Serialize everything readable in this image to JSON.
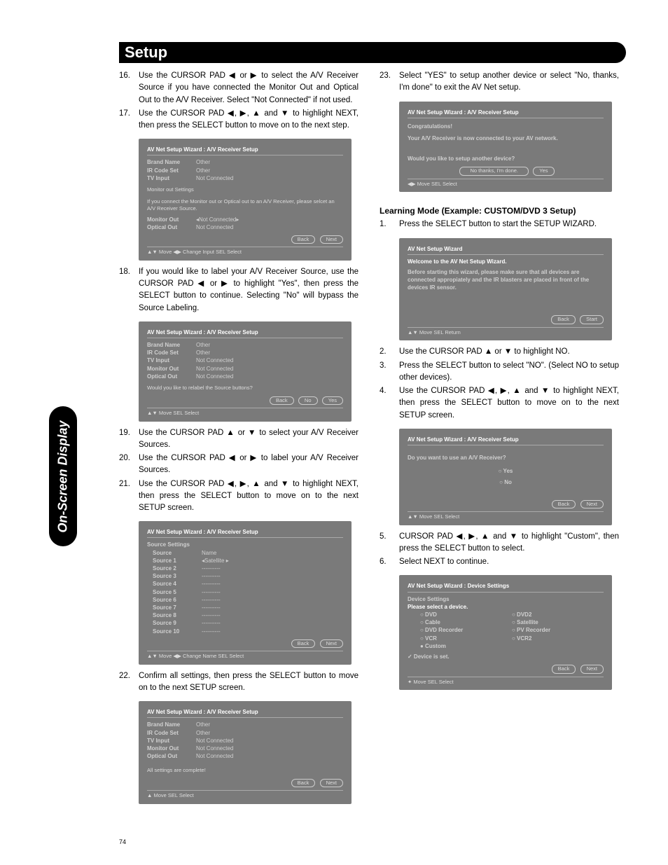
{
  "header": "Setup",
  "sidetab": "On-Screen Display",
  "pagenum": "74",
  "left": {
    "step16": "Use the CURSOR PAD ◀ or ▶ to select the A/V Receiver Source if you have connected the Monitor Out and Optical Out to the A/V Receiver.  Select \"Not Connected\" if not used.",
    "step17": "Use the CURSOR PAD ◀, ▶, ▲ and ▼ to highlight NEXT, then press the SELECT button to move on to the next step.",
    "screen1": {
      "title": "AV Net Setup Wizard : A/V Receiver Setup",
      "rows": [
        [
          "Brand Name",
          "Other"
        ],
        [
          "IR Code Set",
          "Other"
        ],
        [
          "TV Input",
          "Not Connected"
        ]
      ],
      "note1": "Monitor out Settings",
      "note2": "If you connect the Monitor out or Optical out to an A/V Receiver, please selcet an A/V Receiver Source.",
      "rows2": [
        [
          "Monitor Out",
          "◂Not Connected▸"
        ],
        [
          "Optical Out",
          "Not Connected"
        ]
      ],
      "buttons": [
        "Back",
        "Next"
      ],
      "footer": "▲▼ Move   ◀▶ Change Input   SEL Select"
    },
    "step18": "If you would like to label your A/V Receiver Source, use the CURSOR PAD ◀ or ▶ to highlight \"Yes\", then press the SELECT button to continue.  Selecting \"No\" will bypass the Source Labeling.",
    "screen2": {
      "title": "AV Net Setup Wizard : A/V Receiver Setup",
      "rows": [
        [
          "Brand Name",
          "Other"
        ],
        [
          "IR Code Set",
          "Other"
        ],
        [
          "TV Input",
          "Not Connected"
        ],
        [
          "Monitor Out",
          "Not Connected"
        ],
        [
          "Optical Out",
          "Not Connected"
        ]
      ],
      "question": "Would you like to relabel the Source buttons?",
      "buttons": [
        "Back",
        "No",
        "Yes"
      ],
      "footer": "▲▼ Move   SEL Select"
    },
    "step19": "Use the CURSOR PAD ▲ or ▼ to select your A/V Receiver Sources.",
    "step20": "Use the CURSOR PAD ◀ or ▶ to label your A/V Receiver Sources.",
    "step21": "Use the CURSOR PAD ◀, ▶, ▲ and ▼ to highlight NEXT, then press the SELECT button to move on to the next SETUP screen.",
    "screen3": {
      "title": "AV Net Setup Wizard : A/V Receiver Setup",
      "subtitle": "Source Settings",
      "header_row": [
        "Source",
        "Name"
      ],
      "rows": [
        [
          "Source 1",
          "◂Satellite   ▸"
        ],
        [
          "Source 2",
          "----------"
        ],
        [
          "Source 3",
          "----------"
        ],
        [
          "Source 4",
          "----------"
        ],
        [
          "Source 5",
          "----------"
        ],
        [
          "Source 6",
          "----------"
        ],
        [
          "Source 7",
          "----------"
        ],
        [
          "Source 8",
          "----------"
        ],
        [
          "Source 9",
          "----------"
        ],
        [
          "Source 10",
          "----------"
        ]
      ],
      "buttons": [
        "Back",
        "Next"
      ],
      "footer": "▲▼ Move   ◀▶ Change Name   SEL Select"
    },
    "step22": "Confirm all settings, then press the SELECT button to move on to the next SETUP screen.",
    "screen4": {
      "title": "AV Net Setup Wizard : A/V Receiver Setup",
      "rows": [
        [
          "Brand Name",
          "Other"
        ],
        [
          "IR Code Set",
          "Other"
        ],
        [
          "TV Input",
          "Not Connected"
        ],
        [
          "Monitor Out",
          "Not Connected"
        ],
        [
          "Optical Out",
          "Not Connected"
        ]
      ],
      "note": "All settings are complete!",
      "buttons": [
        "Back",
        "Next"
      ],
      "footer": "▲ Move   SEL Select"
    }
  },
  "right": {
    "step23": "Select \"YES\" to setup another device or select \"No, thanks, I'm done\" to exit the AV Net setup.",
    "screen5": {
      "title": "AV Net Setup Wizard : A/V Receiver Setup",
      "line1": "Congratulations!",
      "line2": "Your A/V Receiver is now connected to your AV network.",
      "question": "Would you like to setup another device?",
      "buttons": [
        "No thanks, I'm done.",
        "Yes"
      ],
      "footer": "◀▶ Move   SEL Select"
    },
    "heading": "Learning Mode (Example:  CUSTOM/DVD 3 Setup)",
    "step1": "Press the SELECT button to start the SETUP WIZARD.",
    "screen6": {
      "title": "AV Net Setup Wizard",
      "line1": "Welcome to the AV Net Setup Wizard.",
      "line2": "Before starting this wizard, please make sure that all devices are connected appropiately and the IR blasters are placed in front of the devices IR sensor.",
      "buttons": [
        "Back",
        "Start"
      ],
      "footer": "▲▼ Move  SEL Return"
    },
    "step2": "Use the CURSOR PAD ▲ or ▼ to highlight NO.",
    "step3": "Press the SELECT button to select \"NO\". (Select NO to setup other devices).",
    "step4": "Use the CURSOR PAD ◀, ▶, ▲ and ▼ to highlight NEXT, then press the SELECT button to move on to the next SETUP screen.",
    "screen7": {
      "title": "AV Net Setup Wizard : A/V Receiver Setup",
      "question": "Do you want to use an A/V Receiver?",
      "options": [
        "○ Yes",
        "○ No"
      ],
      "buttons": [
        "Back",
        "Next"
      ],
      "footer": "▲▼ Move  SEL Select"
    },
    "step5": "CURSOR PAD ◀, ▶, ▲ and ▼ to highlight \"Custom\", then press the SELECT button to select.",
    "step6": "Select NEXT to continue.",
    "screen8": {
      "title": "AV Net Setup Wizard : Device Settings",
      "subtitle": "Device Settings",
      "prompt": "Please select a device.",
      "options_left": [
        "○ DVD",
        "○ Cable",
        "○ DVD Recorder",
        "○ VCR",
        "● Custom"
      ],
      "options_right": [
        "○ DVD2",
        "○ Satellite",
        "○ PV Recorder",
        "○ VCR2",
        ""
      ],
      "checkline": "✓  Device is set.",
      "buttons": [
        "Back",
        "Next"
      ],
      "footer": "✦ Move   SEL Select"
    }
  }
}
